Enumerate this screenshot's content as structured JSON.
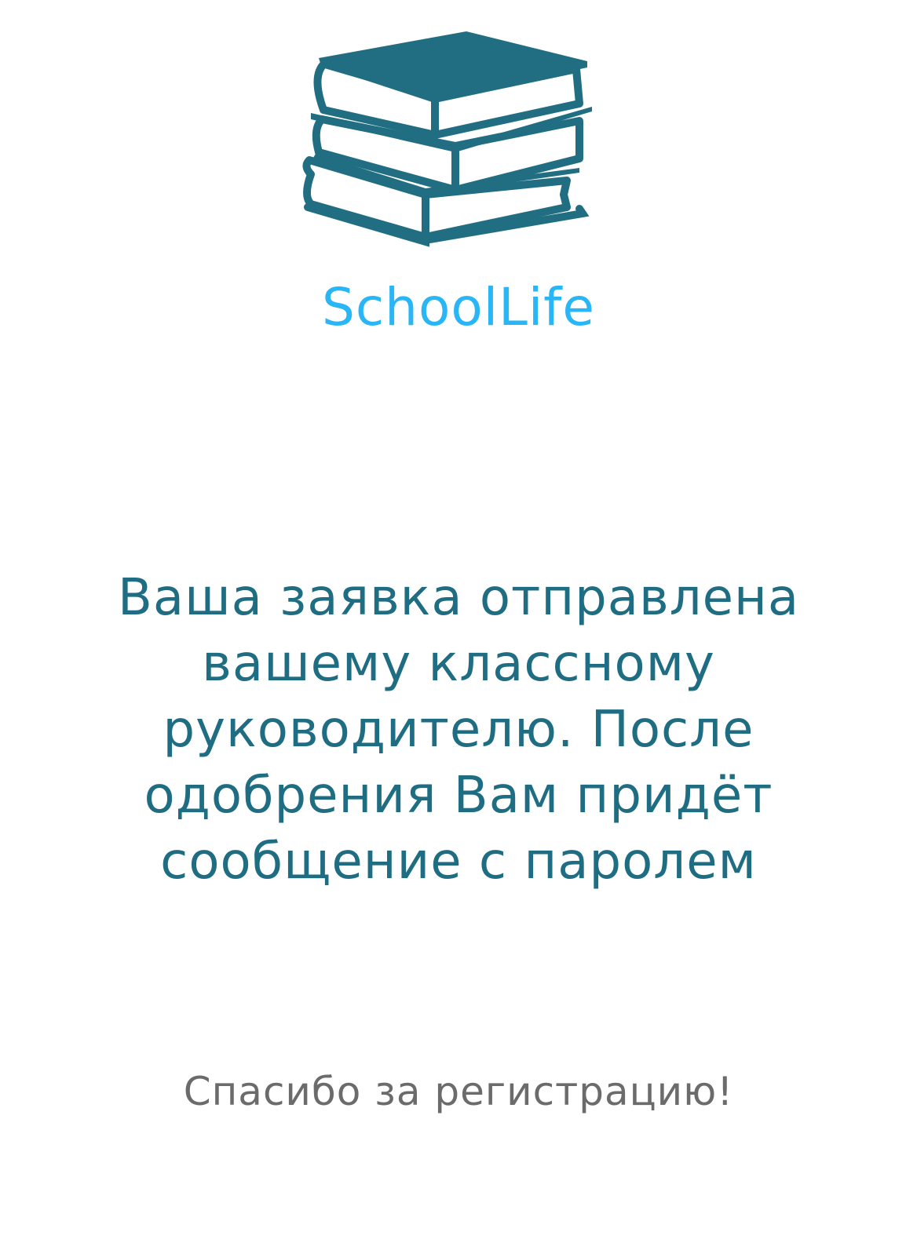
{
  "logo": {
    "icon": "books-stack-icon",
    "color": "#216e82"
  },
  "app": {
    "title": "SchoolLife",
    "title_color": "#29b6f6"
  },
  "message": {
    "text": "Ваша заявка отправлена вашему классному руководителю. После одобрения Вам придёт сообщение с паролем",
    "color": "#1f6d82"
  },
  "footer": {
    "thanks": "Спасибо за регистрацию!",
    "color": "#6b6b6b"
  }
}
